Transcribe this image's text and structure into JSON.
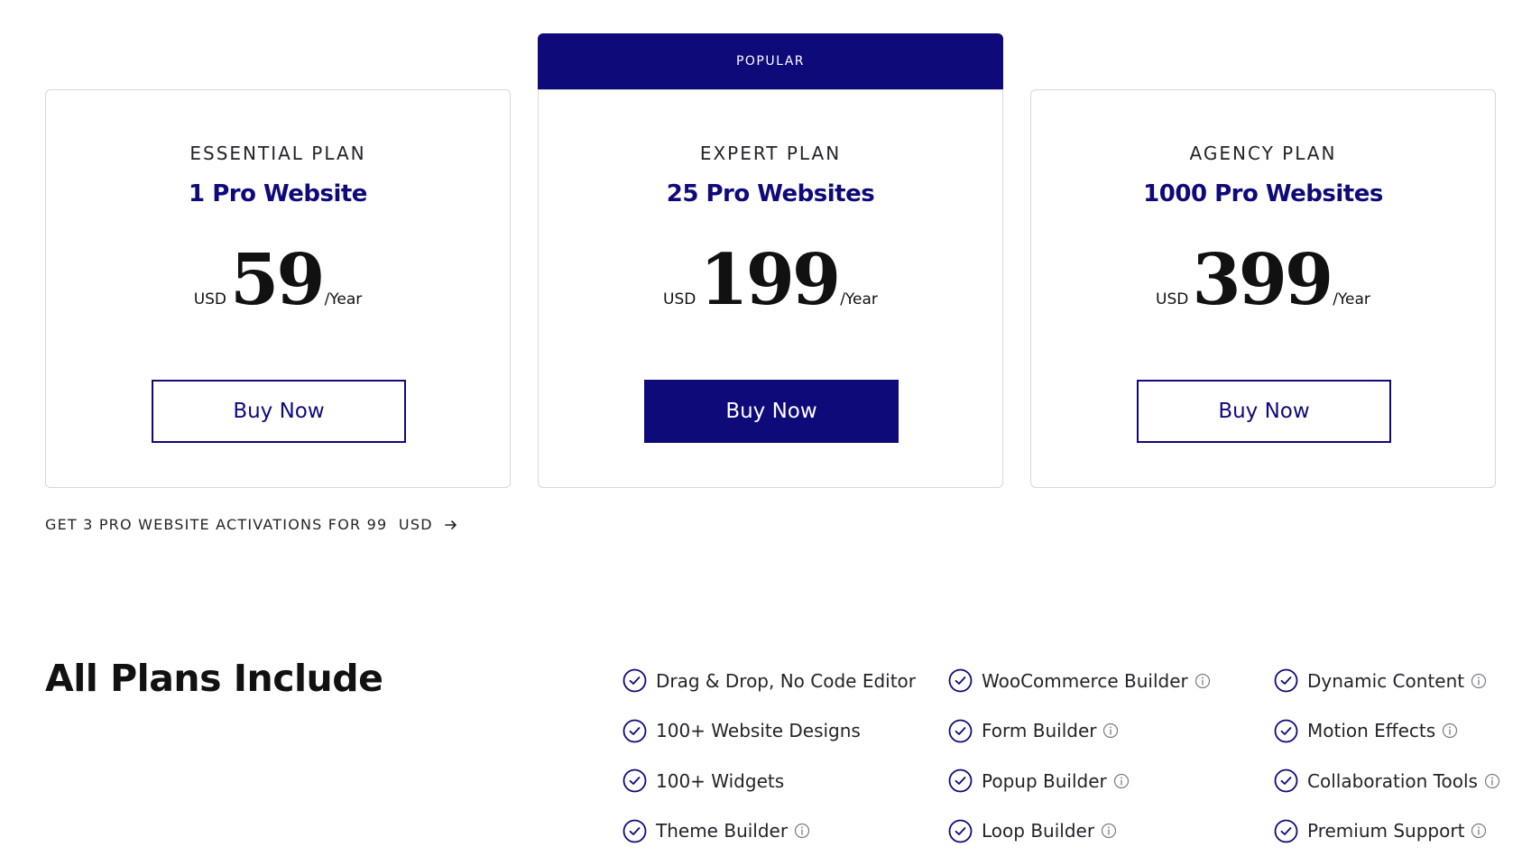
{
  "plans": [
    {
      "name": "ESSENTIAL PLAN",
      "sites": "1 Pro Website",
      "currency": "USD",
      "price": "59",
      "period": "/Year",
      "button": "Buy Now",
      "highlighted": false
    },
    {
      "badge": "POPULAR",
      "name": "EXPERT PLAN",
      "sites": "25 Pro Websites",
      "currency": "USD",
      "price": "199",
      "period": "/Year",
      "button": "Buy Now",
      "highlighted": true
    },
    {
      "name": "AGENCY PLAN",
      "sites": "1000 Pro Websites",
      "currency": "USD",
      "price": "399",
      "period": "/Year",
      "button": "Buy Now",
      "highlighted": false
    }
  ],
  "promo": {
    "label": "GET 3 PRO WEBSITE ACTIVATIONS FOR 99  USD",
    "icon": "arrow-right-icon"
  },
  "includes": {
    "title": "All Plans Include",
    "columns": [
      [
        {
          "label": "Drag & Drop, No Code Editor",
          "info": false
        },
        {
          "label": "100+ Website Designs",
          "info": false
        },
        {
          "label": "100+ Widgets",
          "info": false
        },
        {
          "label": "Theme Builder",
          "info": true
        }
      ],
      [
        {
          "label": "WooCommerce Builder",
          "info": true
        },
        {
          "label": "Form Builder",
          "info": true
        },
        {
          "label": "Popup Builder",
          "info": true
        },
        {
          "label": "Loop Builder",
          "info": true
        }
      ],
      [
        {
          "label": "Dynamic Content",
          "info": true
        },
        {
          "label": "Motion Effects",
          "info": true
        },
        {
          "label": "Collaboration Tools",
          "info": true
        },
        {
          "label": "Premium Support",
          "info": true
        }
      ]
    ]
  },
  "colors": {
    "brand": "#0f0a7a",
    "text": "#23232a",
    "border": "#d5d8dc"
  }
}
